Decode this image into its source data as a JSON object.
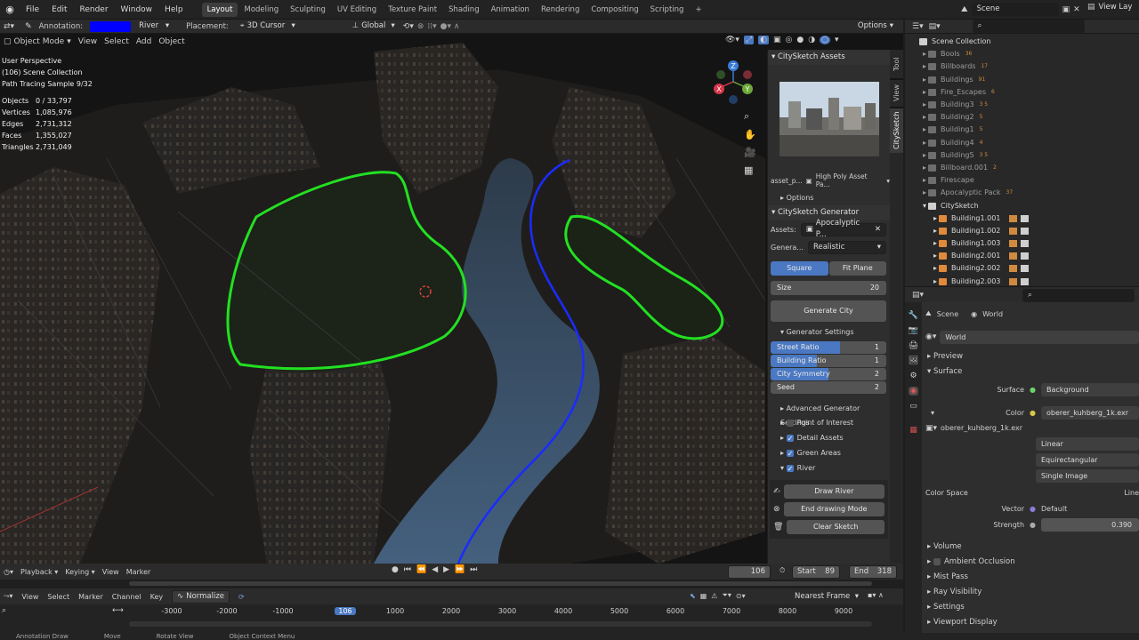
{
  "menu": [
    "File",
    "Edit",
    "Render",
    "Window",
    "Help"
  ],
  "workspaces": [
    "Layout",
    "Modeling",
    "Sculpting",
    "UV Editing",
    "Texture Paint",
    "Shading",
    "Animation",
    "Rendering",
    "Compositing",
    "Scripting"
  ],
  "scene_label": "Scene",
  "view_layer_label": "View Lay",
  "toolheader": {
    "annotation_label": "Annotation:",
    "layer_name": "River",
    "layer_color": "#0000ff",
    "placement_label": "Placement:",
    "placement_value": "3D Cursor",
    "orientation": "Global",
    "options": "Options"
  },
  "viewport_header": {
    "mode": "Object Mode",
    "items": [
      "View",
      "Select",
      "Add",
      "Object"
    ]
  },
  "viewport_stats": {
    "perspective": "User Perspective",
    "collection": "(106) Scene Collection",
    "sample": "Path Tracing Sample 9/32",
    "rows": [
      {
        "k": "Objects",
        "v": "0 / 33,797"
      },
      {
        "k": "Vertices",
        "v": "1,085,976"
      },
      {
        "k": "Edges",
        "v": "2,731,312"
      },
      {
        "k": "Faces",
        "v": "1,355,027"
      },
      {
        "k": "Triangles",
        "v": "2,731,049"
      }
    ]
  },
  "gizmo": {
    "x": "X",
    "y": "Y",
    "z": "Z"
  },
  "npanel": {
    "tabs": [
      "Tool",
      "View",
      "CitySketch"
    ],
    "assets_title": "CitySketch Assets",
    "asset_file": "asset_p...",
    "asset_pack": "High Poly Asset Pa...",
    "options_label": "Options",
    "generator_title": "CitySketch Generator",
    "assets_label": "Assets:",
    "assets_value": "Apocalyptic P...",
    "genera_label": "Genera...",
    "genera_value": "Realistic",
    "square": "Square",
    "fit_plane": "Fit Plane",
    "size_label": "Size",
    "size_value": "20",
    "generate_city": "Generate City",
    "generator_settings": "Generator Settings",
    "sliders": [
      {
        "label": "Street Ratio",
        "value": "1",
        "fill": 0.6
      },
      {
        "label": "Building Ratio",
        "value": "1",
        "fill": 0.4
      },
      {
        "label": "City Symmetry",
        "value": "2",
        "fill": 0.5
      },
      {
        "label": "Seed",
        "value": "2",
        "fill": 0
      }
    ],
    "advanced_settings": "Advanced Generator Settings",
    "checkboxes": [
      {
        "label": "Point of Interest",
        "checked": false
      },
      {
        "label": "Detail Assets",
        "checked": true
      },
      {
        "label": "Green Areas",
        "checked": true
      },
      {
        "label": "River",
        "checked": true
      }
    ],
    "draw_river": "Draw River",
    "end_drawing": "End drawing Mode",
    "clear_sketch": "Clear Sketch"
  },
  "timeline": {
    "playback": "Playback",
    "keying": "Keying",
    "view": "View",
    "marker": "Marker",
    "current_frame": "106",
    "start_label": "Start",
    "start_value": "89",
    "end_label": "End",
    "end_value": "318"
  },
  "graph_header": {
    "items": [
      "View",
      "Select",
      "Marker",
      "Channel",
      "Key"
    ],
    "normalize": "Normalize",
    "interpolation": "Nearest Frame"
  },
  "ruler": {
    "ticks": [
      "-3000",
      "-2000",
      "-1000",
      "106",
      "1000",
      "2000",
      "3000",
      "4000",
      "5000",
      "6000",
      "7000",
      "8000",
      "9000"
    ]
  },
  "statusbar": [
    "Annotation Draw",
    "Move",
    "Rotate View",
    "Object Context Menu"
  ],
  "outliner": {
    "root": "Scene Collection",
    "items": [
      {
        "name": "Bools",
        "count": "36",
        "main": false
      },
      {
        "name": "Billboards",
        "count": "17",
        "main": false
      },
      {
        "name": "Buildings",
        "count": "91",
        "main": false
      },
      {
        "name": "Fire_Escapes",
        "count": "6",
        "main": false
      },
      {
        "name": "Building3",
        "count": "3 5",
        "main": false
      },
      {
        "name": "Building2",
        "count": "5",
        "main": false
      },
      {
        "name": "Building1",
        "count": "5",
        "main": false
      },
      {
        "name": "Building4",
        "count": "4",
        "main": false
      },
      {
        "name": "Building5",
        "count": "3 5",
        "main": false
      },
      {
        "name": "Billboard.001",
        "count": "2",
        "main": false
      },
      {
        "name": "Firescape",
        "count": "",
        "main": false
      },
      {
        "name": "Apocalyptic Pack",
        "count": "37",
        "main": false
      },
      {
        "name": "CitySketch",
        "count": "",
        "main": true
      },
      {
        "name": "Building1.001",
        "count": "",
        "main": true
      },
      {
        "name": "Building1.002",
        "count": "",
        "main": true
      },
      {
        "name": "Building1.003",
        "count": "",
        "main": true
      },
      {
        "name": "Building2.001",
        "count": "",
        "main": true
      },
      {
        "name": "Building2.002",
        "count": "",
        "main": true
      },
      {
        "name": "Building2.003",
        "count": "",
        "main": true
      }
    ]
  },
  "properties": {
    "scene": "Scene",
    "world": "World",
    "world_name": "World",
    "preview": "Preview",
    "surface": "Surface",
    "surface_label": "Surface",
    "surface_value": "Background",
    "color_label": "Color",
    "color_value": "oberer_kuhberg_1k.exr",
    "image_name": "oberer_kuhberg_1k.exr",
    "interp": "Linear",
    "projection": "Equirectangular",
    "source": "Single Image",
    "colorspace_label": "Color Space",
    "colorspace_value": "Line",
    "vector_label": "Vector",
    "vector_value": "Default",
    "strength_label": "Strength",
    "strength_value": "0.390",
    "sections": [
      "Volume",
      "Ambient Occlusion",
      "Mist Pass",
      "Ray Visibility",
      "Settings",
      "Viewport Display"
    ]
  }
}
